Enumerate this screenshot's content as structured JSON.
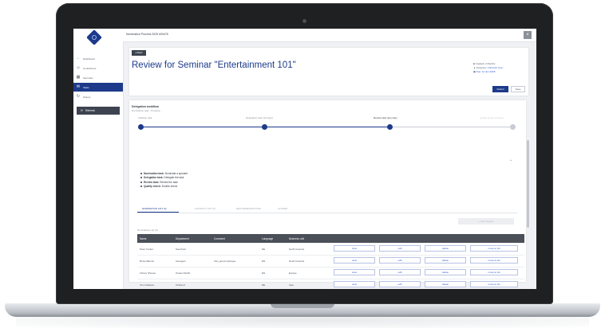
{
  "topbar": {
    "breadcrumb": "Nomination Process 2025 #00476",
    "close_label": "×"
  },
  "sidebar": {
    "items": [
      {
        "icon": "arrow-left-icon",
        "glyph": "←",
        "label": "Dashboard",
        "active": false
      },
      {
        "icon": "user-icon",
        "glyph": "☺",
        "label": "Contributors",
        "active": false
      },
      {
        "icon": "calendar-icon",
        "glyph": "▦",
        "label": "Seminars",
        "active": false
      },
      {
        "icon": "inbox-icon",
        "glyph": "✉",
        "label": "Tasks",
        "active": true
      },
      {
        "icon": "history-icon",
        "glyph": "↻",
        "label": "History",
        "active": false
      }
    ],
    "refresh_button": {
      "glyph": "⟳",
      "label": "Refresh"
    }
  },
  "header": {
    "back_label": "◂ Back",
    "title": "Review for Seminar \"Entertainment 101\"",
    "meta": {
      "created": "Created: 2 Months",
      "assignee_prefix": "Assignee:",
      "assignee": "Unknown Gue...",
      "due": "Due: 14 Jun 2025"
    },
    "submit_label": "Submit",
    "save_label": "Save"
  },
  "workflow": {
    "title": "Delegation workflow",
    "subtitle": "Nomination task · Proposa...",
    "steps": [
      {
        "label": "Initiation task",
        "state": "done"
      },
      {
        "label": "Delegation task (12 days)",
        "state": "done"
      },
      {
        "label": "Review task (any day)",
        "state": "current"
      },
      {
        "label": "Quality check (3 days)",
        "state": "todo"
      }
    ]
  },
  "bullets": [
    {
      "title": "Nomination task:",
      "text": "Nominate a speaker"
    },
    {
      "title": "Delegation task:",
      "text": "Delegate the task"
    },
    {
      "title": "Review task:",
      "text": "Review the task"
    },
    {
      "title": "Quality check:",
      "text": "Double-check"
    }
  ],
  "tabs": [
    {
      "label": "NOMINATION LIST (4)",
      "active": true
    },
    {
      "label": "CONTACT LIST (0)",
      "active": false
    },
    {
      "label": "RECOMMENDATIONS",
      "active": false
    },
    {
      "label": "CLOSED",
      "active": false
    }
  ],
  "assign_label": "+ Add speaker",
  "table": {
    "caption": "Nominations (4) (4)",
    "headers": [
      "Name",
      "Department",
      "Comment",
      "Language",
      "Business unit"
    ],
    "rows": [
      {
        "name": "Peter Tucker",
        "department": "Sea Point",
        "comment": "",
        "language": "DE",
        "unit": "North America"
      },
      {
        "name": "Bruce Banner",
        "department": "Avengers",
        "comment": "Very good employee",
        "language": "EN",
        "unit": "North America"
      },
      {
        "name": "Victory Shouse",
        "department": "Ocean Pacific",
        "comment": "",
        "language": "EN",
        "unit": "Europe"
      },
      {
        "name": "Tom Clarkson",
        "department": "Ozbrand",
        "comment": "",
        "language": "DE",
        "unit": "Asia"
      }
    ],
    "actions": [
      "view",
      "edit",
      "delete",
      "move to list"
    ]
  }
}
